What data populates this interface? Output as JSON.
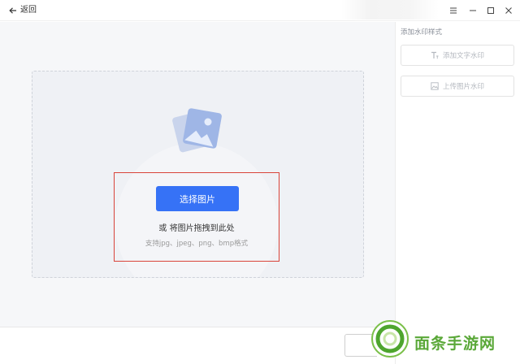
{
  "titlebar": {
    "back_label": "返回",
    "controls": [
      "menu-icon",
      "minimize-icon",
      "maximize-icon",
      "close-icon"
    ]
  },
  "upload": {
    "select_button": "选择图片",
    "drag_hint": "或 将图片拖拽到此处",
    "supported_formats": "支持jpg、jpeg、png、bmp格式"
  },
  "panel": {
    "title": "添加水印样式",
    "add_text_watermark": "添加文字水印",
    "upload_image_watermark": "上传图片水印"
  },
  "colors": {
    "accent": "#3672f6",
    "highlight_box": "#d9443a",
    "watermark_green": "#5aa838"
  },
  "watermark": {
    "logo_text": "面条手游网"
  }
}
